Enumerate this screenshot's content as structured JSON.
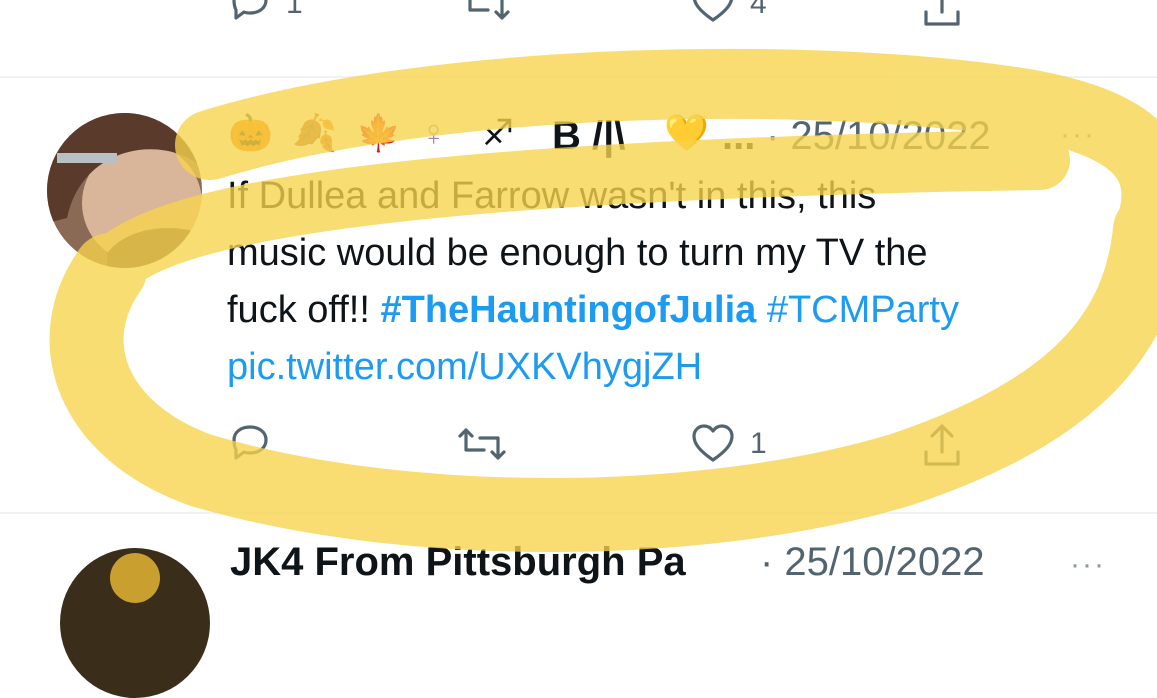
{
  "previous_tweet": {
    "reply_count": "1",
    "like_count": "4"
  },
  "tweet": {
    "display_name_emojis": [
      "🎃",
      "🍂",
      "🍁",
      "♀",
      "♐"
    ],
    "display_name_text": "B /|\\",
    "heart_emoji": "💛",
    "ellipsis": "...",
    "date": "· 25/10/2022",
    "more": "···",
    "text_line1": "If Dullea and Farrow wasn't in this, this",
    "text_line2": "music would be enough to turn my TV the",
    "text_line3_prefix": "fuck off!! ",
    "hashtag1": "#TheHauntingofJulia",
    "hashtag2": " #TCMParty",
    "pic_link": "pic.twitter.com/UXKVhygjZH",
    "like_count": "1"
  },
  "next_tweet": {
    "display_name": "JK4 From Pittsburgh Pa",
    "date": "· 25/10/2022",
    "more": "···"
  },
  "colors": {
    "highlight": "#f7d44c",
    "link": "#1d9bf0",
    "muted": "#536471"
  }
}
